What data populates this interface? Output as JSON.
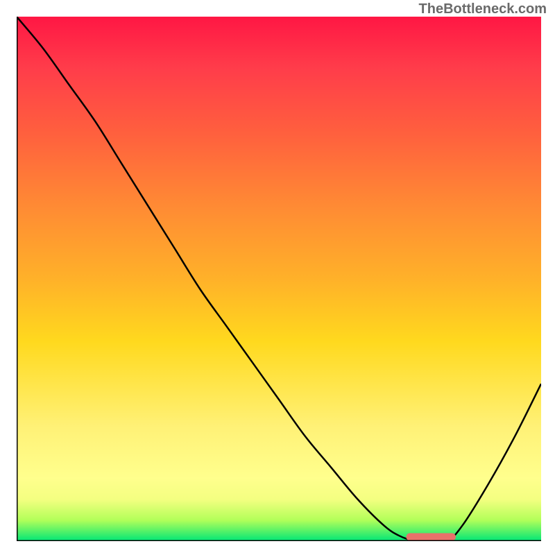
{
  "watermark": "TheBottleneck.com",
  "chart_data": {
    "type": "line",
    "title": "",
    "xlabel": "",
    "ylabel": "",
    "xlim": [
      0,
      100
    ],
    "ylim": [
      0,
      100
    ],
    "grid": false,
    "legend": false,
    "x": [
      0,
      5,
      10,
      15,
      20,
      25,
      30,
      35,
      40,
      45,
      50,
      55,
      60,
      65,
      70,
      73,
      76,
      78,
      82,
      85,
      90,
      95,
      100
    ],
    "values": [
      100,
      94,
      87,
      80,
      72,
      64,
      56,
      48,
      41,
      34,
      27,
      20,
      14,
      8,
      3,
      1,
      0,
      0,
      0,
      3,
      11,
      20,
      30
    ],
    "marker": {
      "x_start": 75,
      "x_end": 83,
      "y": 0
    },
    "background_gradient": [
      "#ff1744",
      "#ff8a34",
      "#ffd91e",
      "#fff176",
      "#00e676"
    ]
  }
}
